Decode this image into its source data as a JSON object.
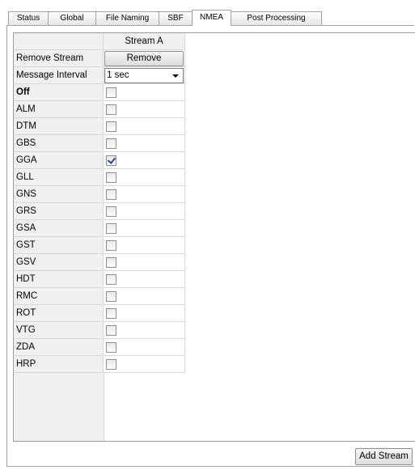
{
  "tabs": [
    {
      "label": "Status",
      "active": false
    },
    {
      "label": "Global",
      "active": false
    },
    {
      "label": "File Naming",
      "active": false
    },
    {
      "label": "SBF",
      "active": false
    },
    {
      "label": "NMEA",
      "active": true
    },
    {
      "label": "Post Processing",
      "active": false
    }
  ],
  "grid": {
    "column_header": "Stream A",
    "remove_row_label": "Remove Stream",
    "remove_button_label": "Remove",
    "interval_row_label": "Message Interval",
    "interval_value": "1 sec",
    "messages": [
      {
        "label": "Off",
        "checked": false
      },
      {
        "label": "ALM",
        "checked": false
      },
      {
        "label": "DTM",
        "checked": false
      },
      {
        "label": "GBS",
        "checked": false
      },
      {
        "label": "GGA",
        "checked": true
      },
      {
        "label": "GLL",
        "checked": false
      },
      {
        "label": "GNS",
        "checked": false
      },
      {
        "label": "GRS",
        "checked": false
      },
      {
        "label": "GSA",
        "checked": false
      },
      {
        "label": "GST",
        "checked": false
      },
      {
        "label": "GSV",
        "checked": false
      },
      {
        "label": "HDT",
        "checked": false
      },
      {
        "label": "RMC",
        "checked": false
      },
      {
        "label": "ROT",
        "checked": false
      },
      {
        "label": "VTG",
        "checked": false
      },
      {
        "label": "ZDA",
        "checked": false
      },
      {
        "label": "HRP",
        "checked": false
      }
    ]
  },
  "add_stream_label": "Add Stream"
}
